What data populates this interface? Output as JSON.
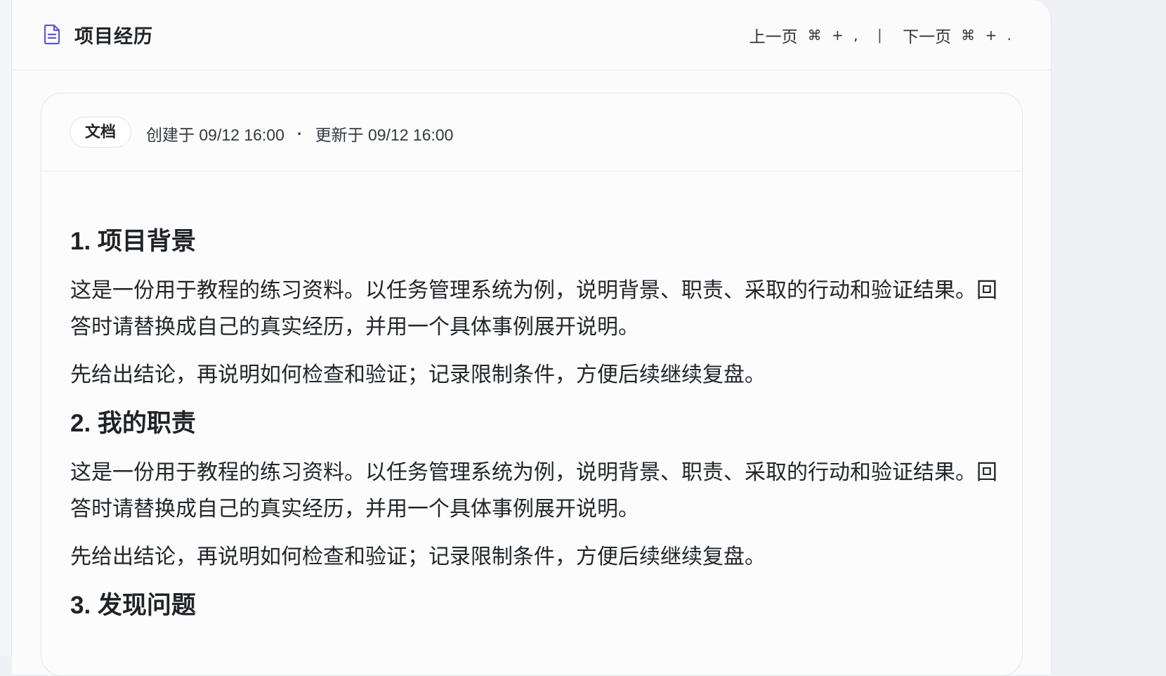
{
  "header": {
    "title": "项目经历",
    "prev_label": "上一页",
    "prev_shortcut": "⌘ + ,",
    "separator": "|",
    "next_label": "下一页",
    "next_shortcut": "⌘ + ."
  },
  "meta": {
    "badge": "文档",
    "created": "创建于 09/12 16:00",
    "dot": "·",
    "updated": "更新于 09/12 16:00"
  },
  "sections": [
    {
      "heading": "1. 项目背景",
      "para1": "这是一份用于教程的练习资料。以任务管理系统为例，说明背景、职责、采取的行动和验证结果。回答时请替换成自己的真实经历，并用一个具体事例展开说明。",
      "para2": "先给出结论，再说明如何检查和验证；记录限制条件，方便后续继续复盘。"
    },
    {
      "heading": "2. 我的职责",
      "para1": "这是一份用于教程的练习资料。以任务管理系统为例，说明背景、职责、采取的行动和验证结果。回答时请替换成自己的真实经历，并用一个具体事例展开说明。",
      "para2": "先给出结论，再说明如何检查和验证；记录限制条件，方便后续继续复盘。"
    },
    {
      "heading": "3. 发现问题"
    }
  ],
  "colors": {
    "icon_accent": "#5b5bd6",
    "background": "#eef0f4",
    "panel": "#fbfbfc"
  },
  "icons": {
    "document": "document-icon"
  }
}
